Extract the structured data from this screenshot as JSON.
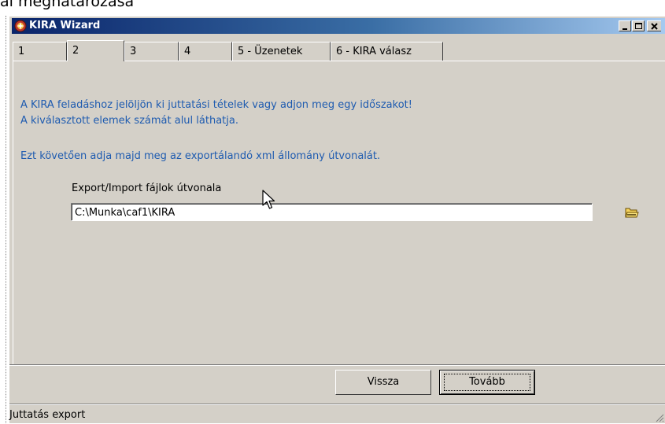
{
  "page": {
    "heading_fragment": "al meghatározása"
  },
  "window": {
    "title": "KIRA Wizard",
    "controls": {
      "minimize": "minimize",
      "maximize": "maximize",
      "close": "close"
    }
  },
  "tabs": [
    {
      "label": "1",
      "active": false
    },
    {
      "label": "2",
      "active": true
    },
    {
      "label": "3",
      "active": false
    },
    {
      "label": "4",
      "active": false
    },
    {
      "label": "5 - Üzenetek",
      "active": false
    },
    {
      "label": "6 - KIRA válasz",
      "active": false
    }
  ],
  "content": {
    "info_line1": "A KIRA feladáshoz jelöljön ki juttatási tételek vagy adjon meg egy időszakot!",
    "info_line2": "A kiválasztott elemek számát alul láthatja.",
    "info_line3": "Ezt követően adja majd meg az exportálandó xml állomány útvonalát.",
    "path_label": "Export/Import fájlok útvonala",
    "path_value": "C:\\Munka\\caf1\\KIRA"
  },
  "buttons": {
    "back": "Vissza",
    "next": "Tovább"
  },
  "status": {
    "text": "Juttatás export"
  },
  "colors": {
    "info_text": "#1e5bb0",
    "title_start": "#0a246a",
    "title_end": "#a6caf0",
    "face": "#d4d0c8"
  },
  "icons": {
    "app": "kira-app-icon",
    "folder": "folder-open-icon",
    "cursor": "mouse-pointer-icon"
  }
}
